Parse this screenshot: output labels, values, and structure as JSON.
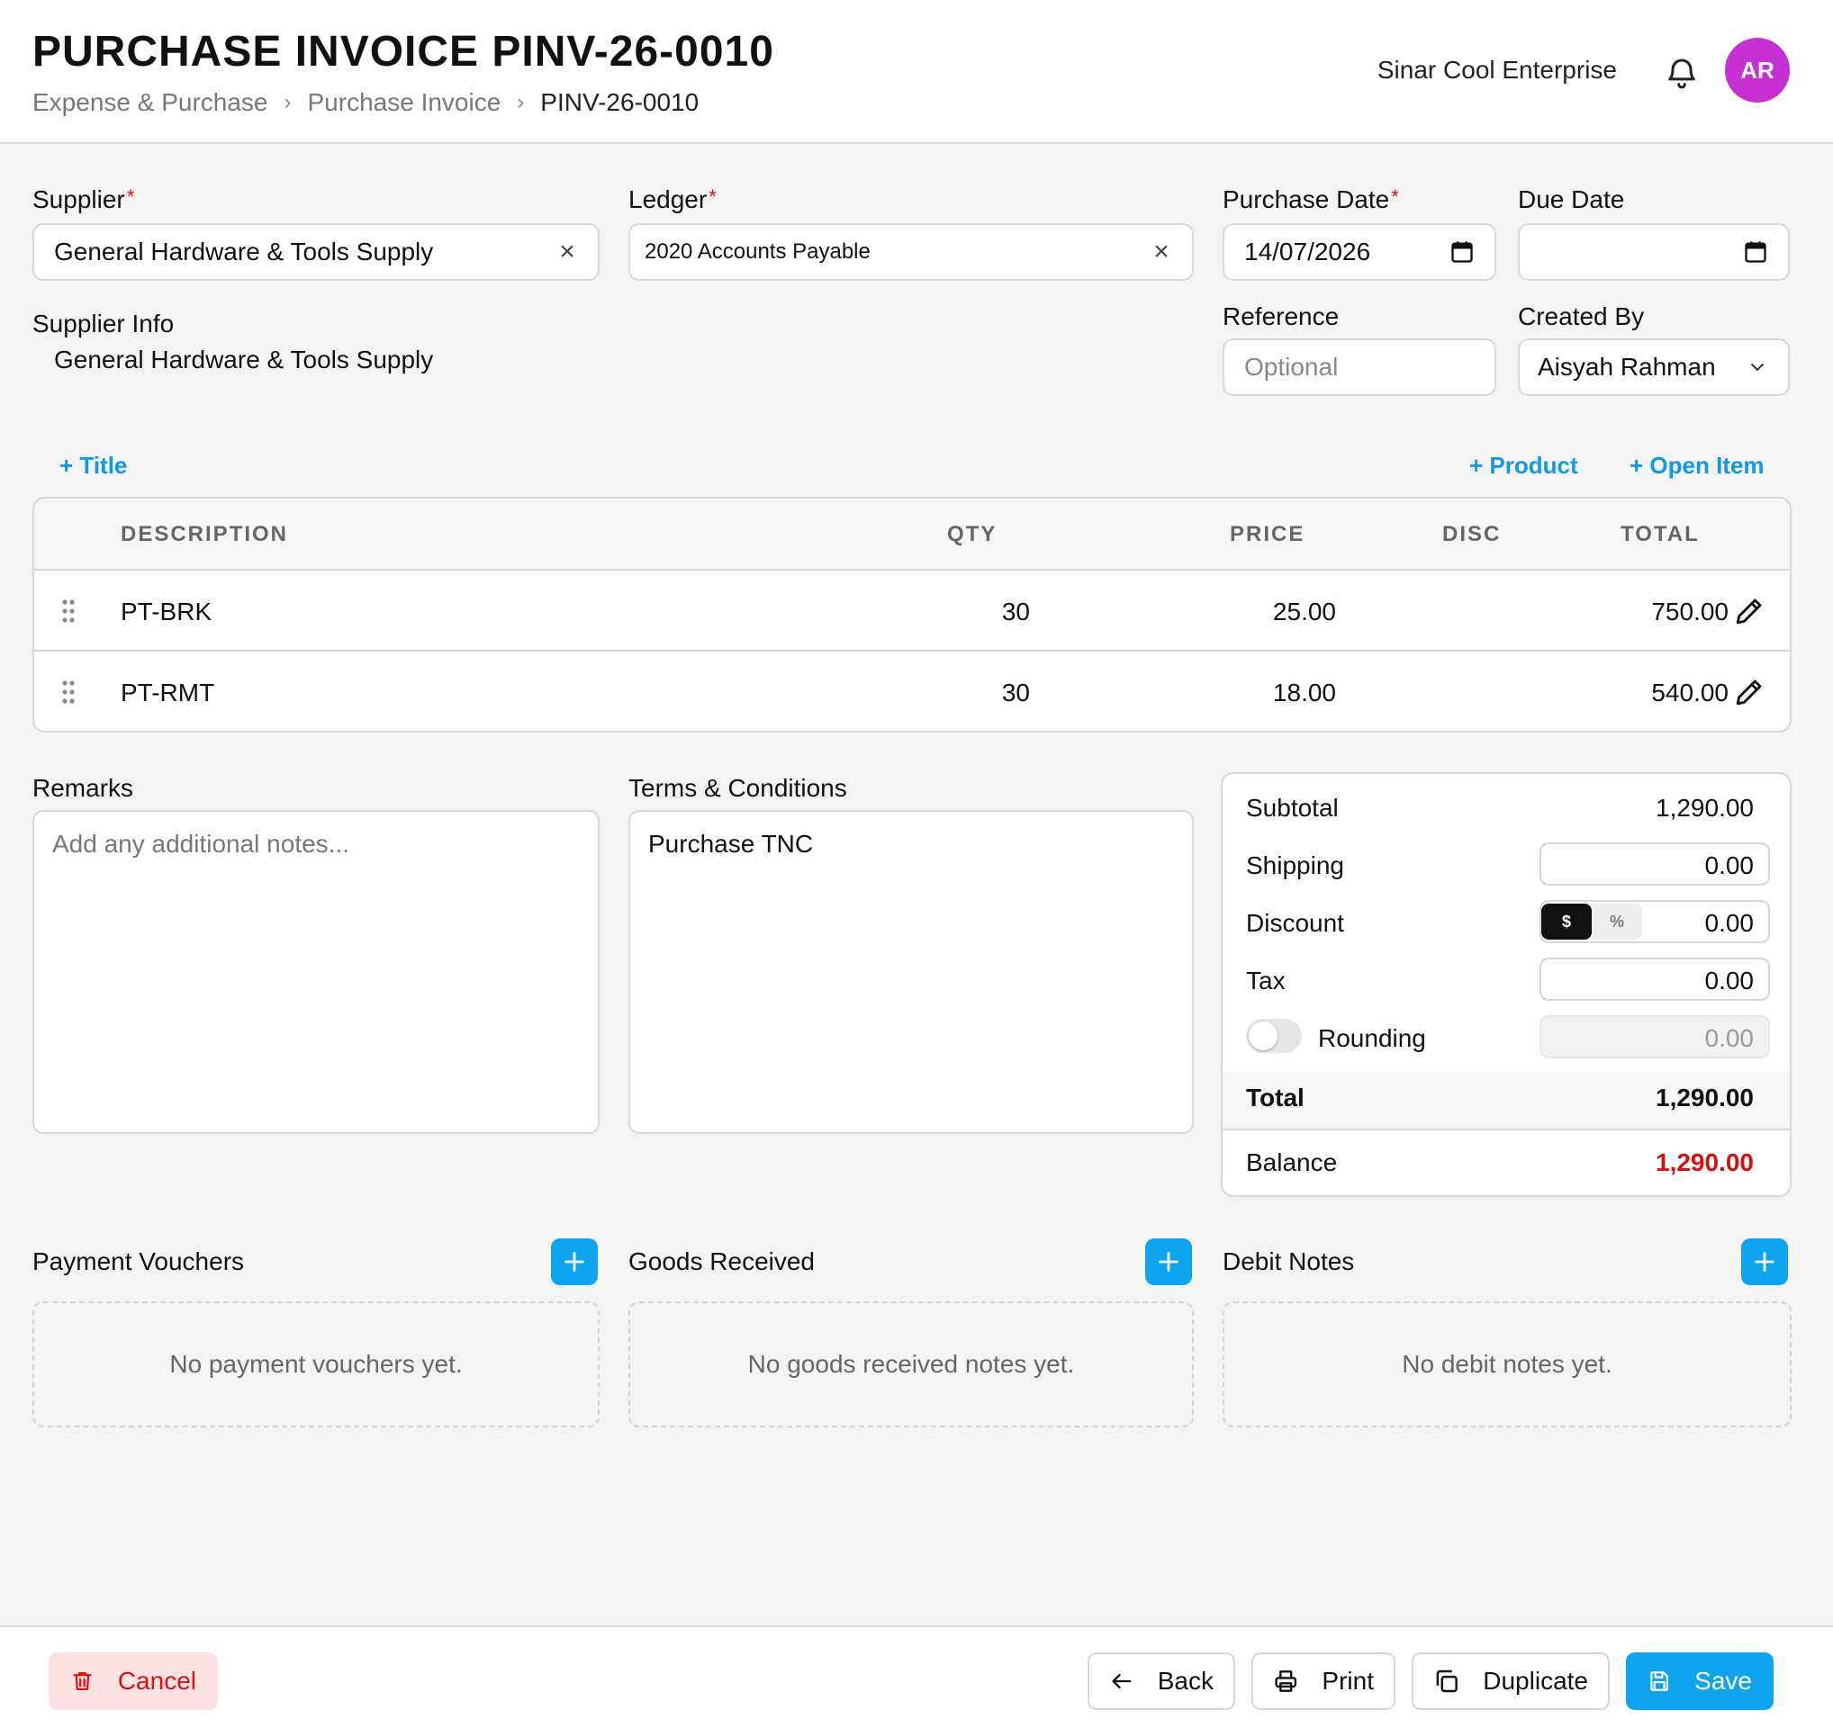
{
  "header": {
    "title": "PURCHASE INVOICE PINV-26-0010",
    "breadcrumb": [
      "Expense & Purchase",
      "Purchase Invoice",
      "PINV-26-0010"
    ],
    "company": "Sinar Cool Enterprise",
    "avatar_initials": "AR",
    "avatar_color": "#c62fd1"
  },
  "form": {
    "supplier": {
      "label": "Supplier",
      "value": "General Hardware & Tools Supply"
    },
    "ledger": {
      "label": "Ledger",
      "value": "2020 Accounts Payable"
    },
    "purchase_date": {
      "label": "Purchase Date",
      "value": "14/07/2026"
    },
    "due_date": {
      "label": "Due Date",
      "value": ""
    },
    "supplier_info": {
      "label": "Supplier Info",
      "value": "General Hardware & Tools Supply"
    },
    "reference": {
      "label": "Reference",
      "placeholder": "Optional",
      "value": ""
    },
    "created_by": {
      "label": "Created By",
      "value": "Aisyah Rahman"
    }
  },
  "actions": {
    "add_title": "+ Title",
    "add_product": "+ Product",
    "add_open_item": "+ Open Item"
  },
  "table": {
    "columns": [
      "DESCRIPTION",
      "QTY",
      "PRICE",
      "DISC",
      "TOTAL"
    ],
    "rows": [
      {
        "description": "PT-BRK",
        "qty": "30",
        "price": "25.00",
        "disc": "",
        "total": "750.00"
      },
      {
        "description": "PT-RMT",
        "qty": "30",
        "price": "18.00",
        "disc": "",
        "total": "540.00"
      }
    ]
  },
  "remarks": {
    "label": "Remarks",
    "placeholder": "Add any additional notes...",
    "value": ""
  },
  "terms": {
    "label": "Terms & Conditions",
    "value": "Purchase TNC"
  },
  "summary": {
    "subtotal_label": "Subtotal",
    "subtotal": "1,290.00",
    "shipping_label": "Shipping",
    "shipping": "0.00",
    "discount_label": "Discount",
    "discount": "0.00",
    "discount_mode_amount": "$",
    "discount_mode_percent": "%",
    "tax_label": "Tax",
    "tax": "0.00",
    "rounding_label": "Rounding",
    "rounding": "0.00",
    "total_label": "Total",
    "total": "1,290.00",
    "balance_label": "Balance",
    "balance": "1,290.00",
    "balance_color": "#d11111"
  },
  "related": {
    "payment_vouchers": {
      "title": "Payment Vouchers",
      "empty": "No payment vouchers yet."
    },
    "goods_received": {
      "title": "Goods Received",
      "empty": "No goods received notes yet."
    },
    "debit_notes": {
      "title": "Debit Notes",
      "empty": "No debit notes yet."
    }
  },
  "footer": {
    "cancel": "Cancel",
    "back": "Back",
    "print": "Print",
    "duplicate": "Duplicate",
    "save": "Save"
  },
  "colors": {
    "accent": "#0ea5ee",
    "link": "#1199e6",
    "danger": "#d11111"
  }
}
